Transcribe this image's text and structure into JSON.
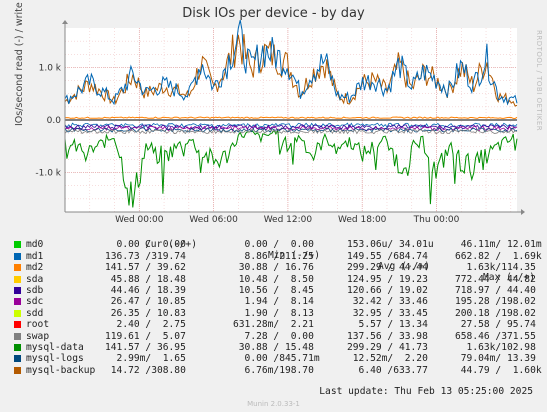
{
  "title": "Disk IOs per device - by day",
  "watermark": "RRDTOOL / TOBI OETIKER",
  "credit": "Munin 2.0.33-1",
  "last_update": "Last update:  Thu Feb 13 05:25:00 2025",
  "legend_header": {
    "cur": "Cur (-/+)",
    "min": "Min (-/+)",
    "avg": "Avg (-/+)",
    "max": "Max (-/+)"
  },
  "legend": [
    {
      "name": "md0",
      "color": "#00cc00",
      "cur": "  0.00 /  0.00",
      "min": "  0.00 /  0.00",
      "avg": "153.06u/ 34.01u",
      "max": " 46.11m/ 12.01m"
    },
    {
      "name": "md1",
      "color": "#0066b3",
      "cur": "136.73 /319.74",
      "min": "  8.86 /211.25",
      "avg": "149.55 /684.74",
      "max": "662.82 /  1.69k"
    },
    {
      "name": "md2",
      "color": "#ff8000",
      "cur": "141.57 / 39.62",
      "min": " 30.88 / 16.76",
      "avg": "299.29 / 44.44",
      "max": "  1.63k/114.35"
    },
    {
      "name": "sda",
      "color": "#ffcc00",
      "cur": " 45.88 / 18.48",
      "min": " 10.48 /  8.50",
      "avg": "124.95 / 19.23",
      "max": "772.44 / 44.82"
    },
    {
      "name": "sdb",
      "color": "#330099",
      "cur": " 44.46 / 18.39",
      "min": " 10.56 /  8.45",
      "avg": "120.66 / 19.02",
      "max": "718.97 / 44.40"
    },
    {
      "name": "sdc",
      "color": "#990099",
      "cur": " 26.47 / 10.85",
      "min": "  1.94 /  8.14",
      "avg": " 32.42 / 33.46",
      "max": "195.28 /198.02"
    },
    {
      "name": "sdd",
      "color": "#ccff00",
      "cur": " 26.35 / 10.83",
      "min": "  1.90 /  8.13",
      "avg": " 32.95 / 33.45",
      "max": "200.18 /198.02"
    },
    {
      "name": "root",
      "color": "#ff0000",
      "cur": "  2.40 /  2.75",
      "min": "631.28m/  2.21",
      "avg": "  5.57 / 13.34",
      "max": " 27.58 / 95.74"
    },
    {
      "name": "swap",
      "color": "#808080",
      "cur": "119.61 /  5.07",
      "min": "  7.28 /  0.00",
      "avg": "137.56 / 33.98",
      "max": "658.46 /371.55"
    },
    {
      "name": "mysql-data",
      "color": "#008f00",
      "cur": "141.57 / 36.95",
      "min": " 30.88 / 15.48",
      "avg": "299.29 / 41.73",
      "max": "  1.63k/102.98"
    },
    {
      "name": "mysql-logs",
      "color": "#00487d",
      "cur": "  2.99m/  1.65",
      "min": "  0.00 /845.71m",
      "avg": " 12.52m/  2.20",
      "max": " 79.04m/ 13.39"
    },
    {
      "name": "mysql-backup",
      "color": "#b35a00",
      "cur": " 14.72 /308.80",
      "min": "  6.76m/198.70",
      "avg": "  6.40 /633.77",
      "max": " 44.79 /  1.60k"
    }
  ],
  "chart_data": {
    "type": "line",
    "title": "Disk IOs per device - by day",
    "ylabel": "IOs/second read (-) / write (+)",
    "xlabel": "",
    "ylim": [
      -1750,
      1750
    ],
    "yticks": [
      -1000,
      0,
      1000
    ],
    "ytick_labels": [
      "-1.0 k",
      "0.0",
      "1.0 k"
    ],
    "xlim_hours": [
      -6,
      30.5
    ],
    "xticks": [
      0,
      6,
      12,
      18,
      24
    ],
    "xtick_labels": [
      "Wed 00:00",
      "Wed 06:00",
      "Wed 12:00",
      "Wed 18:00",
      "Thu 00:00"
    ],
    "grid": true,
    "series_estimated": [
      {
        "name": "mysql-backup",
        "color": "#b35a00",
        "direction": "write",
        "x_hours": [
          -6,
          -4,
          -2,
          -0.5,
          0.5,
          2,
          4,
          5,
          6,
          7,
          8,
          9,
          10,
          11,
          12,
          13,
          14,
          15,
          16,
          17,
          18,
          19,
          20,
          21,
          22,
          23,
          24,
          25,
          26,
          27,
          28,
          29,
          30.5
        ],
        "values": [
          350,
          700,
          350,
          850,
          500,
          650,
          450,
          1100,
          600,
          1000,
          1550,
          950,
          1300,
          1200,
          1050,
          500,
          900,
          1100,
          450,
          400,
          700,
          750,
          550,
          1050,
          600,
          900,
          750,
          550,
          1000,
          650,
          1150,
          450,
          350
        ]
      },
      {
        "name": "md1",
        "color": "#0066b3",
        "direction": "write",
        "x_hours": [
          -6,
          -4,
          -2,
          -0.5,
          0.5,
          2,
          4,
          5,
          6,
          7,
          8,
          9,
          10,
          11,
          12,
          13,
          14,
          15,
          16,
          17,
          18,
          19,
          20,
          21,
          22,
          23,
          24,
          25,
          26,
          27,
          28,
          29,
          30.5
        ],
        "values": [
          360,
          720,
          370,
          870,
          520,
          670,
          470,
          1120,
          620,
          1030,
          1600,
          980,
          1340,
          1230,
          1080,
          520,
          930,
          1130,
          470,
          420,
          720,
          770,
          570,
          1070,
          620,
          930,
          770,
          570,
          1030,
          670,
          1180,
          470,
          360
        ]
      },
      {
        "name": "mysql-data",
        "color": "#008f00",
        "direction": "read",
        "x_hours": [
          -6,
          -4,
          -2,
          -0.5,
          0.5,
          2,
          4,
          5,
          6,
          7,
          8,
          9,
          10,
          11,
          12,
          13,
          14,
          15,
          16,
          17,
          18,
          19,
          20,
          21,
          22,
          23,
          24,
          25,
          26,
          27,
          28,
          29,
          30.5
        ],
        "values": [
          -450,
          -600,
          -300,
          -1600,
          -500,
          -700,
          -350,
          -600,
          -800,
          -700,
          -300,
          -250,
          -350,
          -200,
          -500,
          -300,
          -700,
          -350,
          -500,
          -400,
          -650,
          -500,
          -350,
          -900,
          -550,
          -400,
          -1050,
          -500,
          -800,
          -900,
          -700,
          -500,
          -300
        ]
      },
      {
        "name": "md2",
        "color": "#ff8000",
        "direction": "write",
        "x_hours": [
          -6,
          0,
          6,
          12,
          18,
          24,
          30.5
        ],
        "values": [
          40,
          45,
          45,
          44,
          44,
          45,
          40
        ]
      }
    ]
  }
}
